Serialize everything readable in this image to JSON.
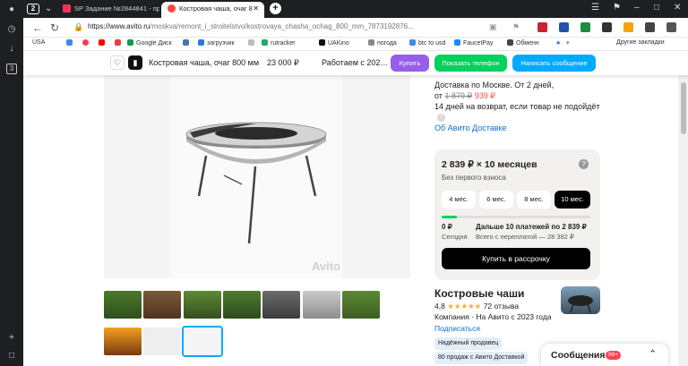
{
  "browser": {
    "tab_count": "2",
    "tabs": [
      {
        "label": "SP Задание №2844841 - про"
      },
      {
        "label": "Костровая чаша, очаг 8"
      }
    ],
    "url_host": "https://www.avito.ru",
    "url_path": "/moskva/remont_i_stroitelstvo/kostrovaya_chasha_ochag_800_mm_7873192876...",
    "sidestrip_badge": "3",
    "colors": {
      "chrome": "#1e1f23",
      "avito_blue": "#00aaff",
      "avito_green": "#02d15c"
    }
  },
  "bookmarks": [
    {
      "label": "USA",
      "icon": "flag-icon"
    },
    {
      "label": "",
      "icon": "google-icon"
    },
    {
      "label": "",
      "icon": "pocket-icon"
    },
    {
      "label": "",
      "icon": "youtube-icon"
    },
    {
      "label": "",
      "icon": "gmail-icon"
    },
    {
      "label": "Google Диск",
      "icon": "drive-icon"
    },
    {
      "label": "",
      "icon": "vk-icon"
    },
    {
      "label": "загрузчик",
      "icon": "downloader-icon"
    },
    {
      "label": "",
      "icon": "bookmark-icon"
    },
    {
      "label": "rutracker",
      "icon": "rutracker-icon"
    },
    {
      "label": "UAKino",
      "icon": "uakino-icon"
    },
    {
      "label": "погода",
      "icon": "weather-icon"
    },
    {
      "label": "btc to usd",
      "icon": "google-icon"
    },
    {
      "label": "FaucetPay",
      "icon": "faucetpay-icon"
    },
    {
      "label": "Обменн",
      "icon": "exchange-icon"
    },
    {
      "label": "Другие закладки",
      "icon": "folder-icon"
    }
  ],
  "sticky": {
    "title": "Костровая чаша, очаг 800 мм",
    "price": "23 000 ₽",
    "work_hours": "Работаем с 202…",
    "buy_label": "Купить",
    "phone_label": "Показать телефон",
    "message_label": "Написать сообщение"
  },
  "listing": {
    "watermark": "Avito",
    "thumbnail_count": 10,
    "selected_thumbnail": 10
  },
  "delivery": {
    "line1": "Доставка по Москве. От 2 дней,",
    "from": "от",
    "old_price": "1 879 ₽",
    "new_price": "939 ₽",
    "returns": "14 дней на возврат, если товар не подойдёт",
    "about_link": "Об Авито Доставке"
  },
  "credit": {
    "title": "2 839 ₽ × 10 месяцев",
    "subtitle": "Без первого взноса",
    "help": "?",
    "months": [
      {
        "label": "4 мес.",
        "selected": false
      },
      {
        "label": "6 мес.",
        "selected": false
      },
      {
        "label": "8 мес.",
        "selected": false
      },
      {
        "label": "10 мес.",
        "selected": true
      }
    ],
    "progress_fraction": 0.1,
    "today_amount": "0 ₽",
    "today_label": "Сегодня",
    "next_label": "Дальше 10 платежей по 2 839 ₽",
    "overpay_label": "Всего с переплатой — 28 382 ₽",
    "button_label": "Купить в рассрочку"
  },
  "seller": {
    "name": "Костровые чаши",
    "rating": "4,8",
    "stars": "★★★★★",
    "reviews": "72 отзыва",
    "company": "Компания · На Авито с 2023 года",
    "subscribe": "Подписаться",
    "badges": [
      "Надёжный продавец",
      "80 продаж с Авито Доставкой"
    ]
  },
  "messages": {
    "label": "Сообщения",
    "count": "99+"
  }
}
